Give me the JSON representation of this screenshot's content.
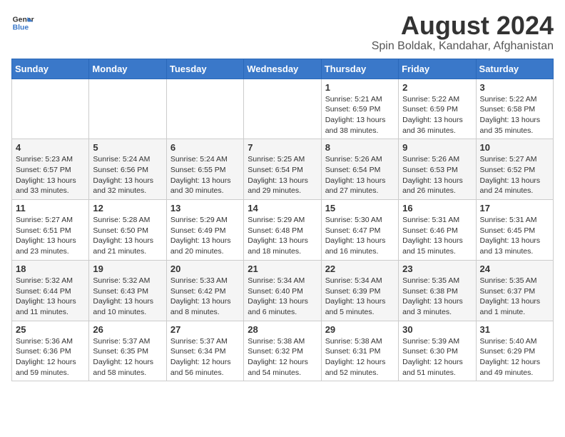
{
  "header": {
    "logo_line1": "General",
    "logo_line2": "Blue",
    "main_title": "August 2024",
    "subtitle": "Spin Boldak, Kandahar, Afghanistan"
  },
  "weekdays": [
    "Sunday",
    "Monday",
    "Tuesday",
    "Wednesday",
    "Thursday",
    "Friday",
    "Saturday"
  ],
  "weeks": [
    [
      {
        "day": "",
        "content": ""
      },
      {
        "day": "",
        "content": ""
      },
      {
        "day": "",
        "content": ""
      },
      {
        "day": "",
        "content": ""
      },
      {
        "day": "1",
        "content": "Sunrise: 5:21 AM\nSunset: 6:59 PM\nDaylight: 13 hours\nand 38 minutes."
      },
      {
        "day": "2",
        "content": "Sunrise: 5:22 AM\nSunset: 6:59 PM\nDaylight: 13 hours\nand 36 minutes."
      },
      {
        "day": "3",
        "content": "Sunrise: 5:22 AM\nSunset: 6:58 PM\nDaylight: 13 hours\nand 35 minutes."
      }
    ],
    [
      {
        "day": "4",
        "content": "Sunrise: 5:23 AM\nSunset: 6:57 PM\nDaylight: 13 hours\nand 33 minutes."
      },
      {
        "day": "5",
        "content": "Sunrise: 5:24 AM\nSunset: 6:56 PM\nDaylight: 13 hours\nand 32 minutes."
      },
      {
        "day": "6",
        "content": "Sunrise: 5:24 AM\nSunset: 6:55 PM\nDaylight: 13 hours\nand 30 minutes."
      },
      {
        "day": "7",
        "content": "Sunrise: 5:25 AM\nSunset: 6:54 PM\nDaylight: 13 hours\nand 29 minutes."
      },
      {
        "day": "8",
        "content": "Sunrise: 5:26 AM\nSunset: 6:54 PM\nDaylight: 13 hours\nand 27 minutes."
      },
      {
        "day": "9",
        "content": "Sunrise: 5:26 AM\nSunset: 6:53 PM\nDaylight: 13 hours\nand 26 minutes."
      },
      {
        "day": "10",
        "content": "Sunrise: 5:27 AM\nSunset: 6:52 PM\nDaylight: 13 hours\nand 24 minutes."
      }
    ],
    [
      {
        "day": "11",
        "content": "Sunrise: 5:27 AM\nSunset: 6:51 PM\nDaylight: 13 hours\nand 23 minutes."
      },
      {
        "day": "12",
        "content": "Sunrise: 5:28 AM\nSunset: 6:50 PM\nDaylight: 13 hours\nand 21 minutes."
      },
      {
        "day": "13",
        "content": "Sunrise: 5:29 AM\nSunset: 6:49 PM\nDaylight: 13 hours\nand 20 minutes."
      },
      {
        "day": "14",
        "content": "Sunrise: 5:29 AM\nSunset: 6:48 PM\nDaylight: 13 hours\nand 18 minutes."
      },
      {
        "day": "15",
        "content": "Sunrise: 5:30 AM\nSunset: 6:47 PM\nDaylight: 13 hours\nand 16 minutes."
      },
      {
        "day": "16",
        "content": "Sunrise: 5:31 AM\nSunset: 6:46 PM\nDaylight: 13 hours\nand 15 minutes."
      },
      {
        "day": "17",
        "content": "Sunrise: 5:31 AM\nSunset: 6:45 PM\nDaylight: 13 hours\nand 13 minutes."
      }
    ],
    [
      {
        "day": "18",
        "content": "Sunrise: 5:32 AM\nSunset: 6:44 PM\nDaylight: 13 hours\nand 11 minutes."
      },
      {
        "day": "19",
        "content": "Sunrise: 5:32 AM\nSunset: 6:43 PM\nDaylight: 13 hours\nand 10 minutes."
      },
      {
        "day": "20",
        "content": "Sunrise: 5:33 AM\nSunset: 6:42 PM\nDaylight: 13 hours\nand 8 minutes."
      },
      {
        "day": "21",
        "content": "Sunrise: 5:34 AM\nSunset: 6:40 PM\nDaylight: 13 hours\nand 6 minutes."
      },
      {
        "day": "22",
        "content": "Sunrise: 5:34 AM\nSunset: 6:39 PM\nDaylight: 13 hours\nand 5 minutes."
      },
      {
        "day": "23",
        "content": "Sunrise: 5:35 AM\nSunset: 6:38 PM\nDaylight: 13 hours\nand 3 minutes."
      },
      {
        "day": "24",
        "content": "Sunrise: 5:35 AM\nSunset: 6:37 PM\nDaylight: 13 hours\nand 1 minute."
      }
    ],
    [
      {
        "day": "25",
        "content": "Sunrise: 5:36 AM\nSunset: 6:36 PM\nDaylight: 12 hours\nand 59 minutes."
      },
      {
        "day": "26",
        "content": "Sunrise: 5:37 AM\nSunset: 6:35 PM\nDaylight: 12 hours\nand 58 minutes."
      },
      {
        "day": "27",
        "content": "Sunrise: 5:37 AM\nSunset: 6:34 PM\nDaylight: 12 hours\nand 56 minutes."
      },
      {
        "day": "28",
        "content": "Sunrise: 5:38 AM\nSunset: 6:32 PM\nDaylight: 12 hours\nand 54 minutes."
      },
      {
        "day": "29",
        "content": "Sunrise: 5:38 AM\nSunset: 6:31 PM\nDaylight: 12 hours\nand 52 minutes."
      },
      {
        "day": "30",
        "content": "Sunrise: 5:39 AM\nSunset: 6:30 PM\nDaylight: 12 hours\nand 51 minutes."
      },
      {
        "day": "31",
        "content": "Sunrise: 5:40 AM\nSunset: 6:29 PM\nDaylight: 12 hours\nand 49 minutes."
      }
    ]
  ]
}
